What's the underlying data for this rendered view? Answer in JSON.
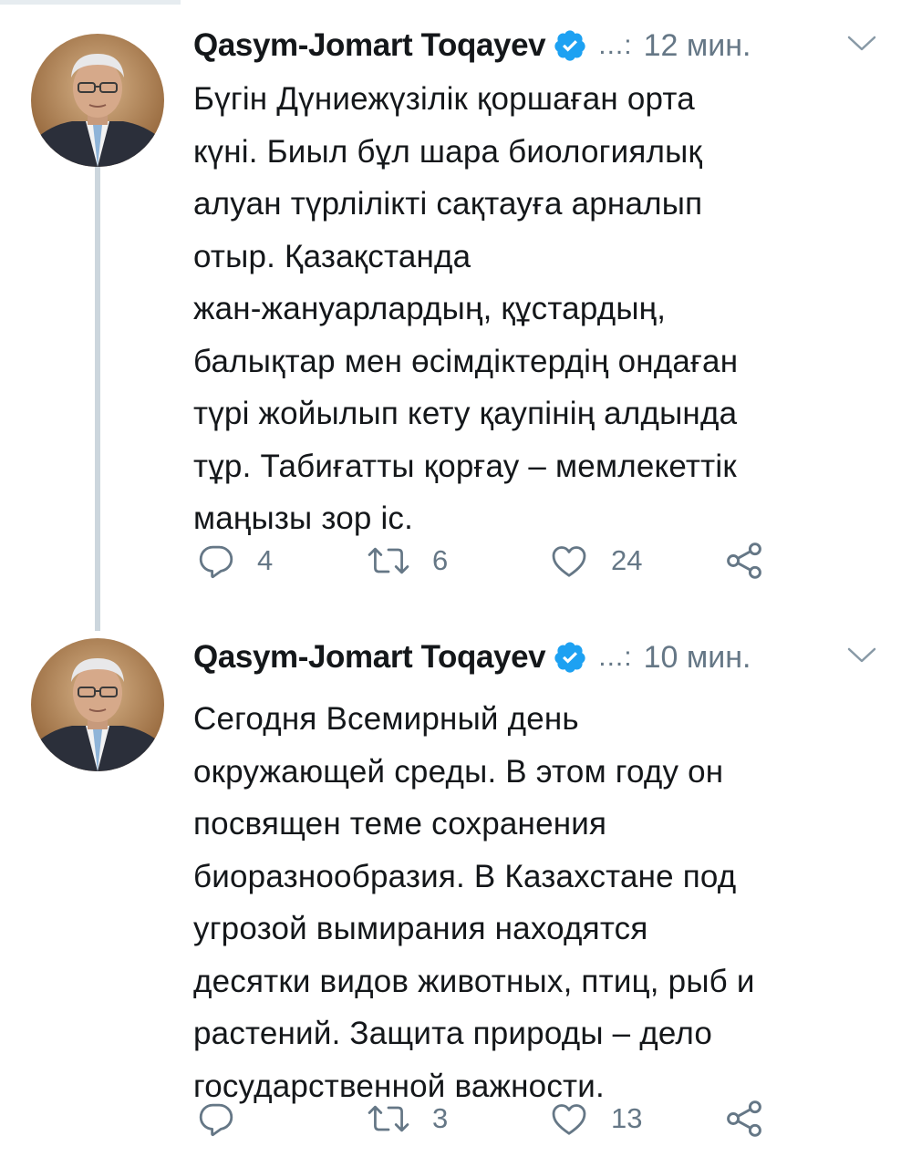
{
  "tweets": [
    {
      "author": "Qasym-Jomart Toqayev",
      "handle": "...:",
      "time": "12 мин.",
      "text": "Бүгін Дүниежүзілік қоршаған орта\nкүні. Биыл бұл шара биологиялық\nалуан түрлілікті сақтауға арналып\nотыр. Қазақстанда\nжан-жануарлардың, құстардың,\nбалықтар мен өсімдіктердің ондаған\nтүрі жойылып кету қаупінің алдында\nтұр. Табиғатты қорғау – мемлекеттік\nмаңызы зор іс.",
      "replies": "4",
      "retweets": "6",
      "likes": "24"
    },
    {
      "author": "Qasym-Jomart Toqayev",
      "handle": "...:",
      "time": "10 мин.",
      "text": "Сегодня Всемирный день\nокружающей среды. В этом году он\nпосвящен теме сохранения\nбиоразнообразия. В Казахстане под\nугрозой вымирания находятся\nдесятки видов животных, птиц, рыб и\nрастений. Защита природы – дело\nгосударственной важности.",
      "replies": "",
      "retweets": "3",
      "likes": "13"
    }
  ],
  "icons": {
    "verified": "verified-badge-icon",
    "caret": "chevron-down-icon",
    "reply": "reply-icon",
    "retweet": "retweet-icon",
    "like": "heart-icon",
    "share": "share-icon"
  },
  "colors": {
    "text": "#14171a",
    "secondary": "#657786",
    "verified": "#1da1f2",
    "thread_line": "#ccd6dd"
  }
}
